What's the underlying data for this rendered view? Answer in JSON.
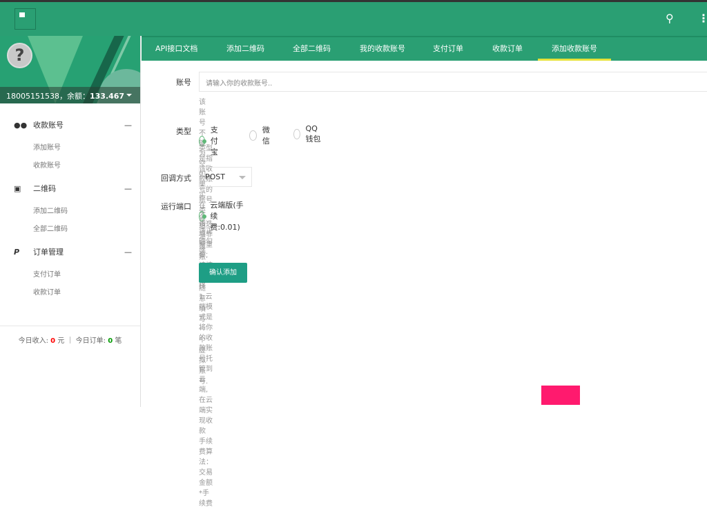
{
  "header": {
    "logo": "logo",
    "search_icon": "search-icon",
    "menu_icon": "more-vertical-icon"
  },
  "user": {
    "phone": "18005151538",
    "balance_label": "，余额：",
    "balance": "133.467"
  },
  "sidebar": [
    {
      "label": "收款账号",
      "icon": "users-icon",
      "items": [
        "添加账号",
        "收款账号"
      ]
    },
    {
      "label": "二维码",
      "icon": "id-card-icon",
      "items": [
        "添加二维码",
        "全部二维码"
      ]
    },
    {
      "label": "订单管理",
      "icon": "paypal-icon",
      "items": [
        "支付订单",
        "收款订单"
      ]
    }
  ],
  "stats": {
    "income_label": "今日收入: ",
    "income": "0",
    "income_unit": " 元 ｜ 今日订单: ",
    "orders": "0",
    "orders_unit": " 笔"
  },
  "tabs": [
    "API接口文档",
    "添加二维码",
    "全部二维码",
    "我的收款账号",
    "支付订单",
    "收款订单",
    "添加收款账号"
  ],
  "active_tab": "添加收款账号",
  "form": {
    "account_label": "账号",
    "account_placeholder": "请输入你的收款账号..",
    "account_value": "",
    "account_hint": "该账号不能为空,如果实在不想泄露账号可随意填写一个虚拟账号.",
    "type_label": "类型",
    "type_options": [
      "支付宝",
      "微信",
      "QQ钱包"
    ],
    "type_selected": "支付宝",
    "type_hint": "类型是指该收款账号的账号类型，请正确勾选.",
    "callback_label": "回调方式",
    "callback_value": "POST",
    "port_label": "运行端口",
    "port_option": "云端版(手续费:0.01)",
    "port_hints": [
      "该选项非常重要,请慎重选择",
      "1.云端模式是将你的收款账号托管到云端,在云端实现收款",
      "手续费算法：交易金额*手续费"
    ],
    "submit": "确认添加"
  },
  "colors": {
    "primary": "#2a9f73",
    "tab_indicator": "#e6e23a",
    "button": "#1e9e85",
    "radio": "#5fb878"
  }
}
